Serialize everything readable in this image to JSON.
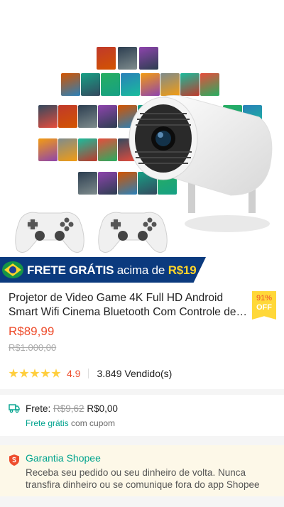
{
  "banner": {
    "text_bold": "FRETE GRÁTIS",
    "text_mid": " acima de ",
    "text_amount": "R$19"
  },
  "product": {
    "title_line1": "Projetor de Video Game 4K Full HD Android",
    "title_line2": "Smart Wifi Cinema Bluetooth Com Controle de Jogos",
    "discount_pct": "91%",
    "discount_label": "OFF",
    "price": "R$89,99",
    "original_price": "R$1.000,00",
    "rating_value": 4.9,
    "rating": "4.9",
    "sold": "3.849 Vendido(s)"
  },
  "shipping": {
    "label": "Frete: ",
    "old_price": "R$9,62",
    "new_price": " R$0,00",
    "free_label": "Frete grátis",
    "coupon_text": " com cupom"
  },
  "guarantee": {
    "title": "Garantia Shopee",
    "text": "Receba seu pedido ou seu dinheiro de volta. Nunca transfira dinheiro ou se comunique fora do app Shopee"
  },
  "colors": {
    "accent": "#ee4d2d",
    "teal": "#00a38e",
    "banner_bg": "#0b3a7e",
    "banner_yellow": "#ffd42a",
    "star": "#ffce3d"
  }
}
